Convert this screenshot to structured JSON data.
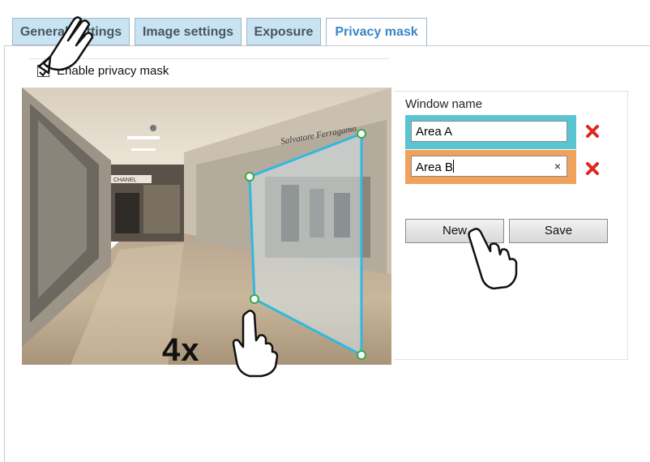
{
  "tabs": [
    {
      "label": "General settings",
      "active": false
    },
    {
      "label": "Image settings",
      "active": false
    },
    {
      "label": "Exposure",
      "active": false
    },
    {
      "label": "Privacy mask",
      "active": true
    }
  ],
  "privacy": {
    "enable_label": "Enable privacy mask",
    "enabled": true
  },
  "video": {
    "store_sign_left": "CHANEL",
    "store_sign_right": "Salvatore Ferragamo"
  },
  "windows": {
    "label": "Window name",
    "items": [
      {
        "value": "Area A",
        "color": "#5bc4d3"
      },
      {
        "value": "Area B",
        "color": "#f0a15c",
        "clear": "×"
      }
    ]
  },
  "buttons": {
    "new_label": "New",
    "save_label": "Save"
  },
  "callout": {
    "repeat": "4x"
  },
  "colors": {
    "mask_outline": "#30b8e0",
    "delete": "#e0261e",
    "tab_bg": "#c8e4f2",
    "tab_active_text": "#3a86c8"
  },
  "icons": [
    "checkbox-check-icon",
    "delete-icon",
    "clear-icon",
    "pointing-hand-icon"
  ]
}
